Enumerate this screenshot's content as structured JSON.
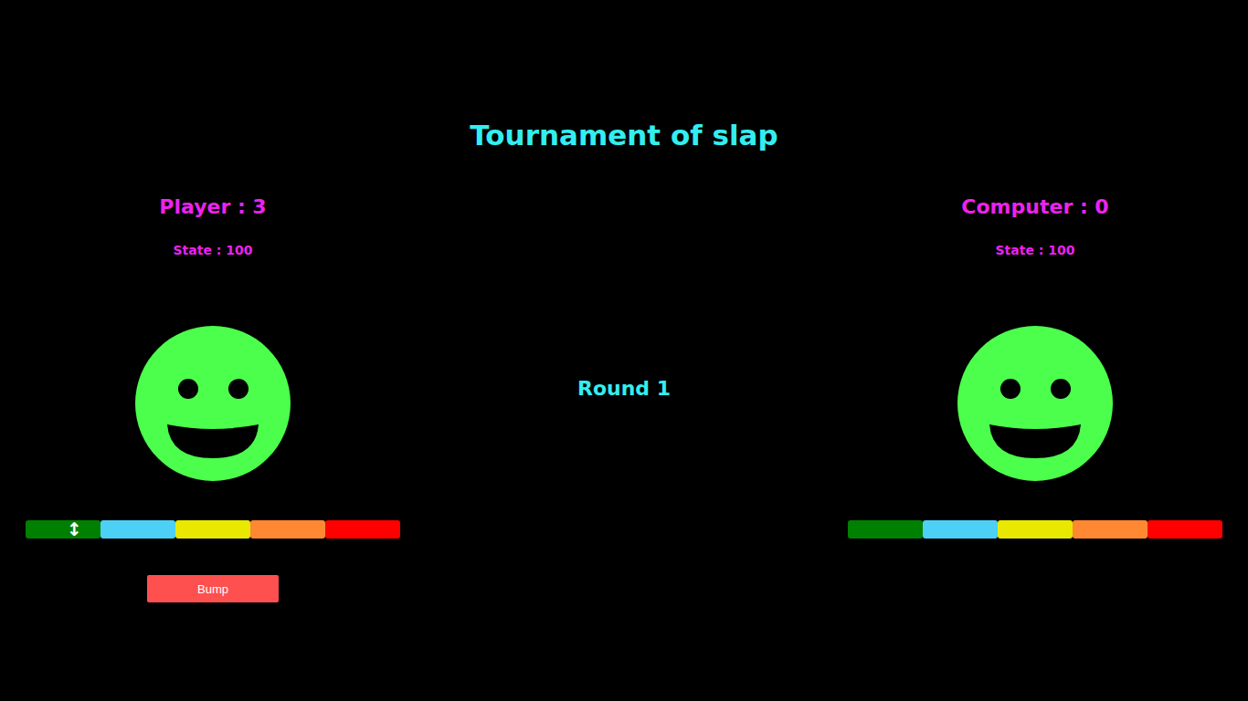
{
  "title": "Tournament of slap",
  "round": "Round 1",
  "fighters": [
    {
      "name": "Player : 3",
      "state": "State : 100",
      "bar": {
        "segments": [
          {
            "color": "#008000"
          },
          {
            "color": "#4dd0f5"
          },
          {
            "color": "#e8e800"
          },
          {
            "color": "#ff8833"
          },
          {
            "color": "#ff0000"
          }
        ],
        "marker": {
          "glyph": "↕",
          "level": 0.13
        }
      },
      "button": "Bump"
    },
    {
      "name": "Computer : 0",
      "state": "State : 100",
      "bar": {
        "segments": [
          {
            "color": "#008000"
          },
          {
            "color": "#4dd0f5"
          },
          {
            "color": "#e8e800"
          },
          {
            "color": "#ff8833"
          },
          {
            "color": "#ff0000"
          }
        ],
        "marker": null
      },
      "button": null
    }
  ]
}
